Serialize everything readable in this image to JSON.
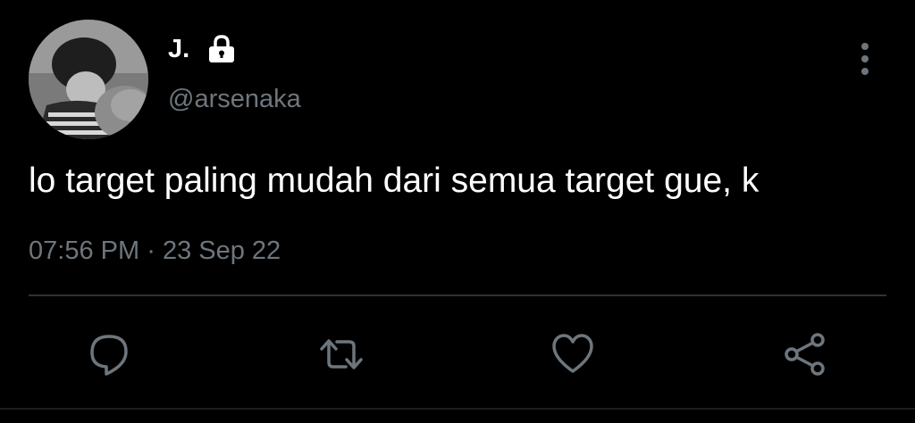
{
  "tweet": {
    "display_name": "J.",
    "handle": "@arsenaka",
    "text": "lo target paling mudah dari semua target gue, k",
    "time": "07:56 PM",
    "separator": "·",
    "date": "23 Sep 22"
  },
  "icons": {
    "avatar": "profile-photo",
    "protected": "lock-icon",
    "more": "more-vertical-icon",
    "reply": "reply-icon",
    "retweet": "retweet-icon",
    "like": "heart-icon",
    "share": "share-icon"
  },
  "colors": {
    "background": "#000000",
    "primary_text": "#ffffff",
    "secondary_text": "#6e767d",
    "divider": "#2f3336"
  }
}
